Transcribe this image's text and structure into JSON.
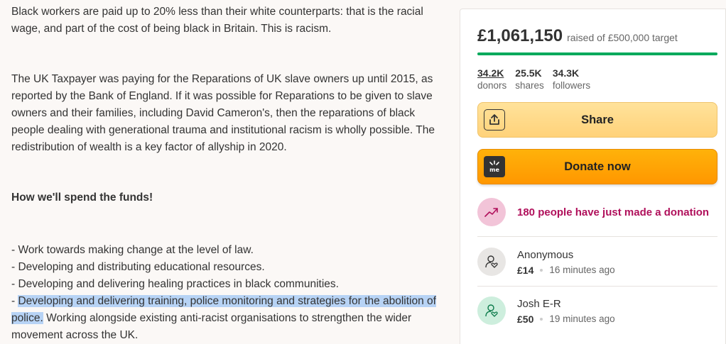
{
  "story": {
    "p1": "Black workers are paid up to 20% less than their white counterparts: that is the racial wage, and part of the cost of being black in Britain. This is racism.",
    "p2": "The UK Taxpayer was paying for the Reparations of UK slave owners up until 2015, as reported by the Bank of England. If it was possible for Reparations to be given to slave owners and their families, including David Cameron's, then the reparations of black people dealing with generational trauma and institutional racism is wholly possible. The redistribution of wealth is a key factor of allyship in 2020.",
    "heading": "How we'll spend the funds!",
    "list": [
      "- Work towards making change at the level of law.",
      "- Developing and distributing educational resources.",
      "- Developing and delivering healing practices in black communities."
    ],
    "last_prefix": "- ",
    "last_highlight": "Developing and delivering training, police monitoring and strategies for the abolition of police.",
    "last_rest": " Working alongside existing anti-racist organisations to strengthen the wider movement across the UK."
  },
  "card": {
    "amount": "£1,061,150",
    "target": "raised of £500,000 target",
    "progress_fraction": 1.0,
    "progress_color": "#02a95c",
    "stats": [
      {
        "num": "34.2K",
        "label": "donors"
      },
      {
        "num": "25.5K",
        "label": "shares"
      },
      {
        "num": "34.3K",
        "label": "followers"
      }
    ],
    "share_label": "Share",
    "donate_label": "Donate now",
    "trend_text": "180 people have just made a donation",
    "donations": [
      {
        "name": "Anonymous",
        "amount": "£14",
        "time": "16 minutes ago"
      },
      {
        "name": "Josh E-R",
        "amount": "£50",
        "time": "19 minutes ago"
      }
    ]
  }
}
